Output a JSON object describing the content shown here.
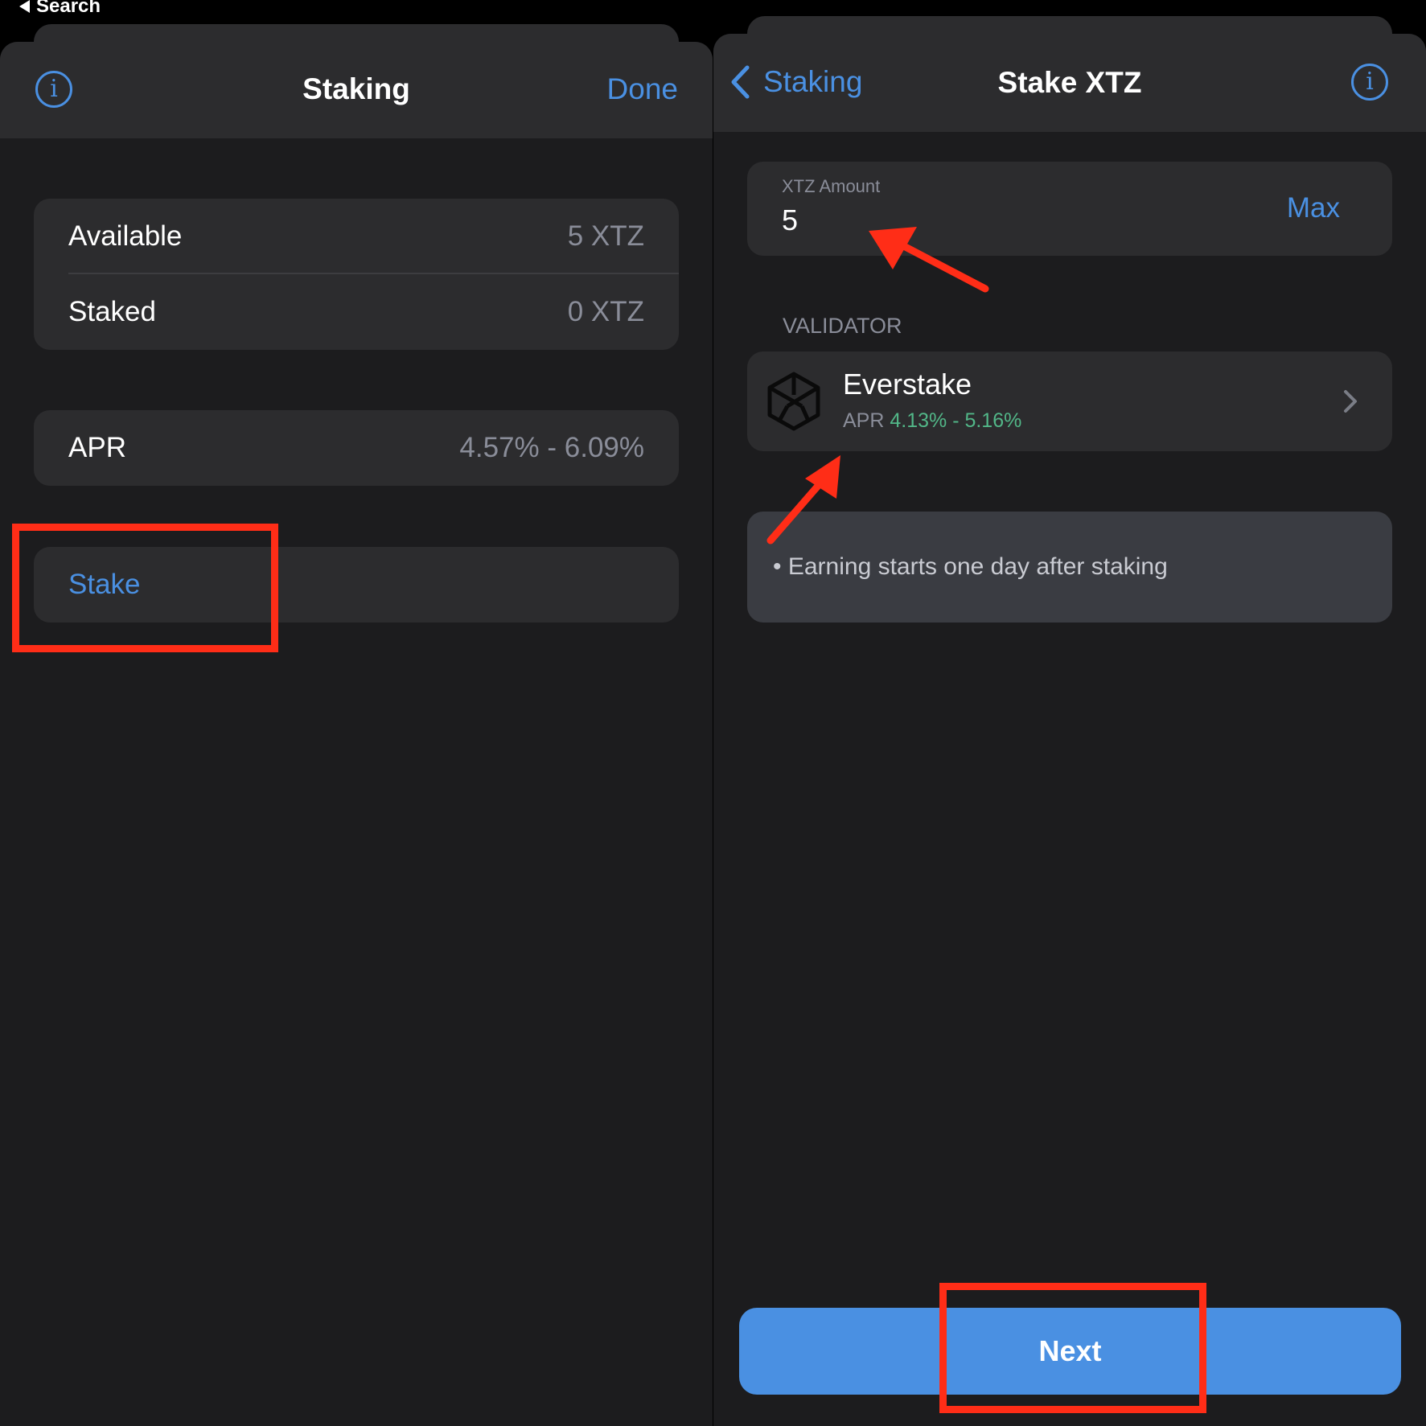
{
  "status_bar": {
    "back_label": "Search"
  },
  "left_panel": {
    "nav": {
      "title": "Staking",
      "done_label": "Done"
    },
    "balances": [
      {
        "label": "Available",
        "value": "5 XTZ"
      },
      {
        "label": "Staked",
        "value": "0 XTZ"
      }
    ],
    "apr": {
      "label": "APR",
      "value": "4.57% - 6.09%"
    },
    "stake_label": "Stake"
  },
  "right_panel": {
    "nav": {
      "back_label": "Staking",
      "title": "Stake XTZ"
    },
    "amount": {
      "label": "XTZ Amount",
      "value": "5",
      "max_label": "Max"
    },
    "validator_section_label": "VALIDATOR",
    "validator": {
      "name": "Everstake",
      "apr_label": "APR",
      "apr_range": "4.13% - 5.16%"
    },
    "notice": {
      "bullet": "•",
      "text": "Earning starts one day after staking"
    },
    "next_label": "Next"
  },
  "colors": {
    "accent": "#4a90e2",
    "positive": "#52b788",
    "annotation": "#ff2d17",
    "background": "#1c1c1e",
    "card": "#2c2c2e"
  },
  "icons": [
    "info-icon",
    "chevron-left-icon",
    "chevron-right-icon",
    "validator-logo-icon"
  ]
}
